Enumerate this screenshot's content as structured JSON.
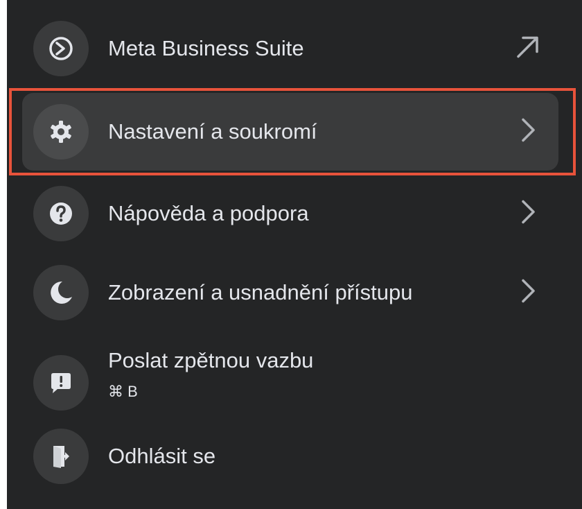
{
  "menu": {
    "items": [
      {
        "label": "Meta Business Suite",
        "icon": "meta-business-suite-icon",
        "trailing": "external-arrow-icon"
      },
      {
        "label": "Nastavení a soukromí",
        "icon": "gear-icon",
        "trailing": "chevron-right-icon",
        "active": true
      },
      {
        "label": "Nápověda a podpora",
        "icon": "question-icon",
        "trailing": "chevron-right-icon"
      },
      {
        "label": "Zobrazení a usnadnění přístupu",
        "icon": "moon-icon",
        "trailing": "chevron-right-icon"
      },
      {
        "label": "Poslat zpětnou vazbu",
        "shortcut": "⌘ B",
        "icon": "feedback-icon"
      },
      {
        "label": "Odhlásit se",
        "icon": "logout-icon"
      }
    ]
  },
  "colors": {
    "background": "#242526",
    "item_active": "#3a3b3c",
    "icon_circle": "#3a3b3c",
    "text": "#e4e6eb",
    "highlight": "#e8533b"
  }
}
